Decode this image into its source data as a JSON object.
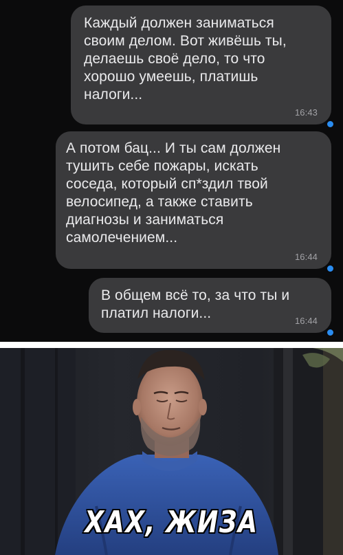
{
  "messages": [
    {
      "text": "Каждый должен заниматься\nсвоим делом. Вот живёшь ты,\nделаешь своё дело, то что\nхорошо умеешь, платишь\nналоги...",
      "time": "16:43"
    },
    {
      "text": "А потом бац... И ты сам должен\nтушить себе пожары, искать\nсоседа, который сп*здил твой\nвелосипед, а также ставить\nдиагнозы и заниматься\nсамолечением...",
      "time": "16:44"
    },
    {
      "text": "В общем всё то, за что ты и\nплатил налоги...",
      "time": "16:44"
    }
  ],
  "meme": {
    "caption": "ХАХ, ЖИЗА"
  },
  "colors": {
    "chat_background": "#0b0b0c",
    "bubble": "#3a3a3c",
    "bubble_text": "#eaeaec",
    "timestamp": "#a2a2a6",
    "read_indicator": "#2a8cf0",
    "sweater": "#2f55a8"
  },
  "icons": [
    "read-status-dot-icon"
  ]
}
